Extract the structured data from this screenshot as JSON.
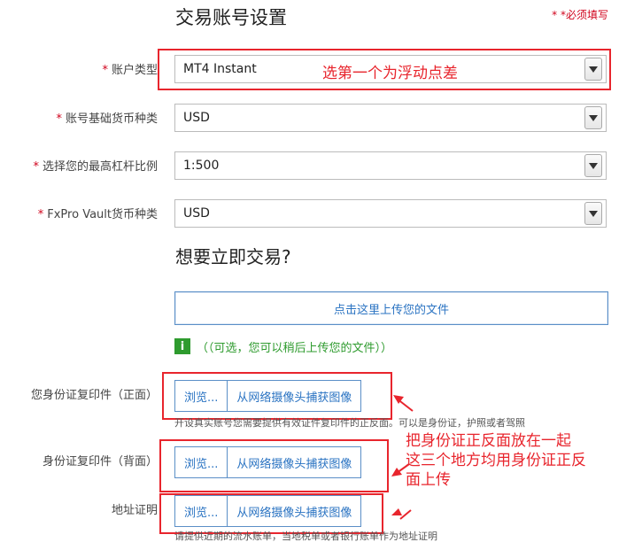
{
  "page": {
    "title": "交易账号设置",
    "required_note": "* *必须填写"
  },
  "fields": [
    {
      "label": "账户类型",
      "value": "MT4 Instant"
    },
    {
      "label": "账号基础货币种类",
      "value": "USD"
    },
    {
      "label": "选择您的最高杠杆比例",
      "value": "1:500"
    },
    {
      "label": "FxPro Vault货币种类",
      "value": "USD"
    }
  ],
  "required_star": "*",
  "trade_now": {
    "heading": "想要立即交易?",
    "upload_label": "点击这里上传您的文件",
    "info_icon": "i",
    "optional_text": "（（可选，您可以稍后上传您的文件））"
  },
  "documents": [
    {
      "label": "您身份证复印件（正面）",
      "browse": "浏览...",
      "webcam": "从网络摄像头捕获图像",
      "hint": "开设真实账号您需要提供有效证件复印件的正反面。可以是身份证，护照或者驾照"
    },
    {
      "label": "身份证复印件（背面）",
      "browse": "浏览...",
      "webcam": "从网络摄像头捕获图像",
      "hint": ""
    },
    {
      "label": "地址证明",
      "browse": "浏览...",
      "webcam": "从网络摄像头捕获图像",
      "hint": "请提供近期的流水账单，当地税单或者银行账单作为地址证明"
    }
  ],
  "annotations": {
    "account_type_note": "选第一个为浮动点差",
    "id_note_1": "把身份证正反面放在一起",
    "id_note_2": "这三个地方均用身份证正反",
    "id_note_3": "面上传"
  },
  "colors": {
    "annotation_red": "#e8252d",
    "link_blue": "#2a73c2",
    "optional_green": "#2e9b2e"
  }
}
